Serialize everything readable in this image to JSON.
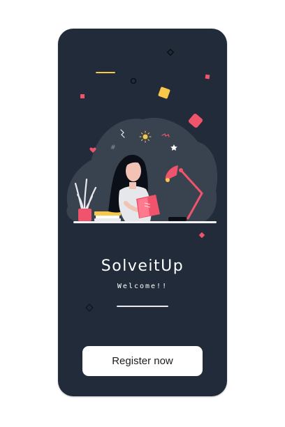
{
  "app": {
    "title": "SolveitUp",
    "subtitle": "Welcome!!"
  },
  "actions": {
    "register_label": "Register now"
  },
  "colors": {
    "background": "#222b3a",
    "accent_pink": "#f0546d",
    "accent_yellow": "#f7c84a",
    "button_bg": "#ffffff"
  },
  "icons": {
    "illustration": "woman-reading-at-desk-illustration"
  }
}
